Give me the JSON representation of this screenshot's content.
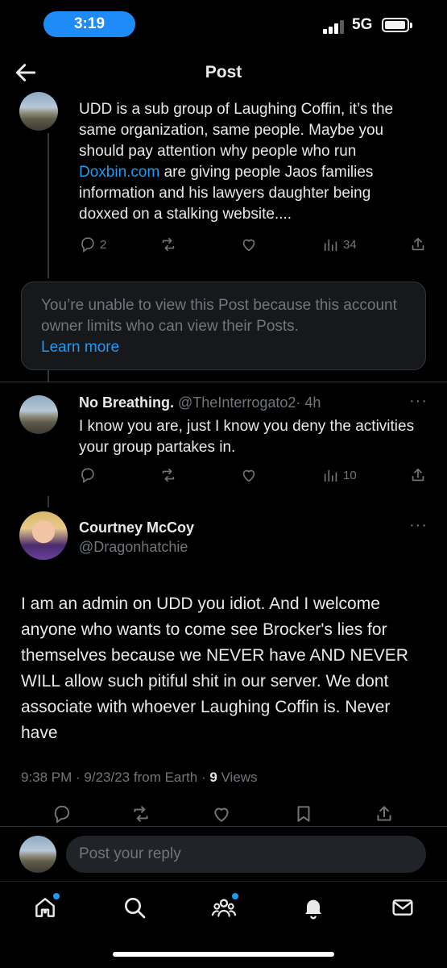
{
  "status_bar": {
    "time": "3:19",
    "network": "5G"
  },
  "header": {
    "title": "Post"
  },
  "reply1": {
    "text_before_link": "UDD is a sub group of Laughing Coffin, it’s the same organization, same people. Maybe you should pay attention why people who run ",
    "link": "Doxbin.com",
    "text_after_link": " are giving people Jaos families information and his lawyers daughter being doxxed on a stalking website....",
    "replies": "2",
    "views": "34"
  },
  "restricted": {
    "message": "You’re unable to view this Post because this account owner limits who can view their Posts.",
    "learn_more": "Learn more"
  },
  "reply2": {
    "name": "No Breathing.",
    "handle": "@TheInterrogato2",
    "time": "· 4h",
    "text": "I know you are, just I know you deny the activities your group partakes in.",
    "views": "10"
  },
  "main_post": {
    "name": "Courtney McCoy",
    "handle": "@Dragonhatchie",
    "text": "I am an admin on UDD you idiot. And I welcome anyone who wants to come see Brocker's lies for themselves because we NEVER have AND NEVER WILL allow such pitiful shit in our server. We dont associate with whoever Laughing Coffin is. Never have",
    "timestamp": "9:38 PM · 9/23/23 from Earth · ",
    "views_count": "9",
    "views_label": " Views"
  },
  "reply_bar": {
    "placeholder": "Post your reply"
  },
  "icons": [
    "back-arrow-icon",
    "reply-icon",
    "repost-icon",
    "like-icon",
    "views-icon",
    "share-icon",
    "bookmark-icon",
    "more-icon",
    "home-icon",
    "search-icon",
    "communities-icon",
    "notifications-icon",
    "messages-icon"
  ],
  "colors": {
    "accent": "#1d9bf0",
    "muted": "#71767b",
    "text": "#e7e9ea",
    "background": "#000000"
  }
}
